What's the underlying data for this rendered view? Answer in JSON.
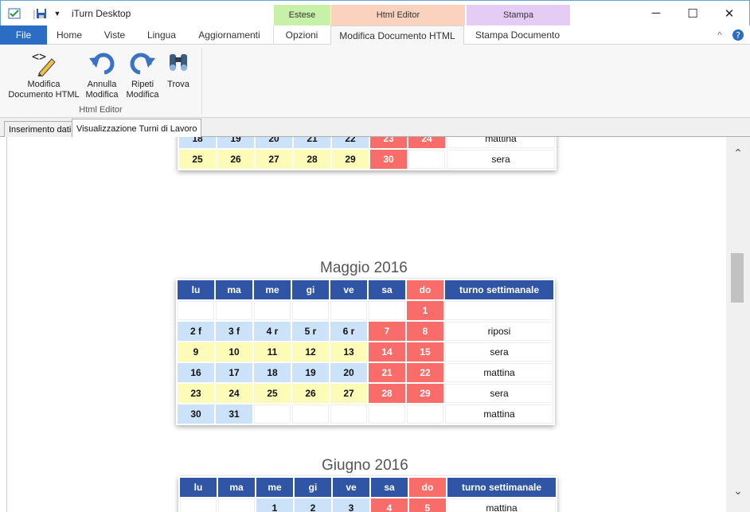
{
  "app": {
    "title": "iTurn Desktop"
  },
  "context_tabs": {
    "estese": "Estese",
    "html_editor": "Html Editor",
    "stampa": "Stampa"
  },
  "ribbon_tabs": [
    "File",
    "Home",
    "Viste",
    "Lingua",
    "Aggiornamenti",
    "Opzioni",
    "Modifica Documento HTML",
    "Stampa Documento"
  ],
  "ribbon": {
    "btn_modifica": "Modifica\nDocumento HTML",
    "btn_annulla": "Annulla\nModifica",
    "btn_ripeti": "Ripeti\nModifica",
    "btn_trova": "Trova",
    "group": "Html Editor"
  },
  "doc_tabs": [
    "Inserimento dati",
    "Visualizzazione Turni di Lavoro"
  ],
  "colors": {
    "header_blue": "#2f55a4",
    "sunday_red": "#f86d6a",
    "cell_blue": "#cce2f8",
    "cell_yellow": "#fdfbb8",
    "file_tab": "#2b6cc4"
  },
  "aprile_partial": {
    "rows": [
      {
        "days": [
          "18",
          "19",
          "20",
          "21",
          "22",
          "23",
          "24"
        ],
        "turno": "mattina",
        "color": "blue"
      },
      {
        "days": [
          "25",
          "26",
          "27",
          "28",
          "29",
          "30",
          ""
        ],
        "turno": "sera",
        "color": "yellow"
      }
    ]
  },
  "maggio": {
    "title": "Maggio 2016",
    "headers": [
      "lu",
      "ma",
      "me",
      "gi",
      "ve",
      "sa",
      "do",
      "turno settimanale"
    ],
    "rows": [
      {
        "days": [
          "",
          "",
          "",
          "",
          "",
          "",
          "1"
        ],
        "turno": "",
        "color": "empty"
      },
      {
        "days": [
          "2 f",
          "3 f",
          "4 r",
          "5 r",
          "6 r",
          "7",
          "8"
        ],
        "turno": "riposi",
        "color": "blue"
      },
      {
        "days": [
          "9",
          "10",
          "11",
          "12",
          "13",
          "14",
          "15"
        ],
        "turno": "sera",
        "color": "yellow"
      },
      {
        "days": [
          "16",
          "17",
          "18",
          "19",
          "20",
          "21",
          "22"
        ],
        "turno": "mattina",
        "color": "blue"
      },
      {
        "days": [
          "23",
          "24",
          "25",
          "26",
          "27",
          "28",
          "29"
        ],
        "turno": "sera",
        "color": "yellow"
      },
      {
        "days": [
          "30",
          "31",
          "",
          "",
          "",
          "",
          ""
        ],
        "turno": "mattina",
        "color": "blue"
      }
    ]
  },
  "giugno": {
    "title": "Giugno 2016",
    "headers": [
      "lu",
      "ma",
      "me",
      "gi",
      "ve",
      "sa",
      "do",
      "turno settimanale"
    ],
    "rows": [
      {
        "days": [
          "",
          "",
          "1",
          "2",
          "3",
          "4",
          "5"
        ],
        "turno": "mattina",
        "color": "blue"
      }
    ]
  }
}
